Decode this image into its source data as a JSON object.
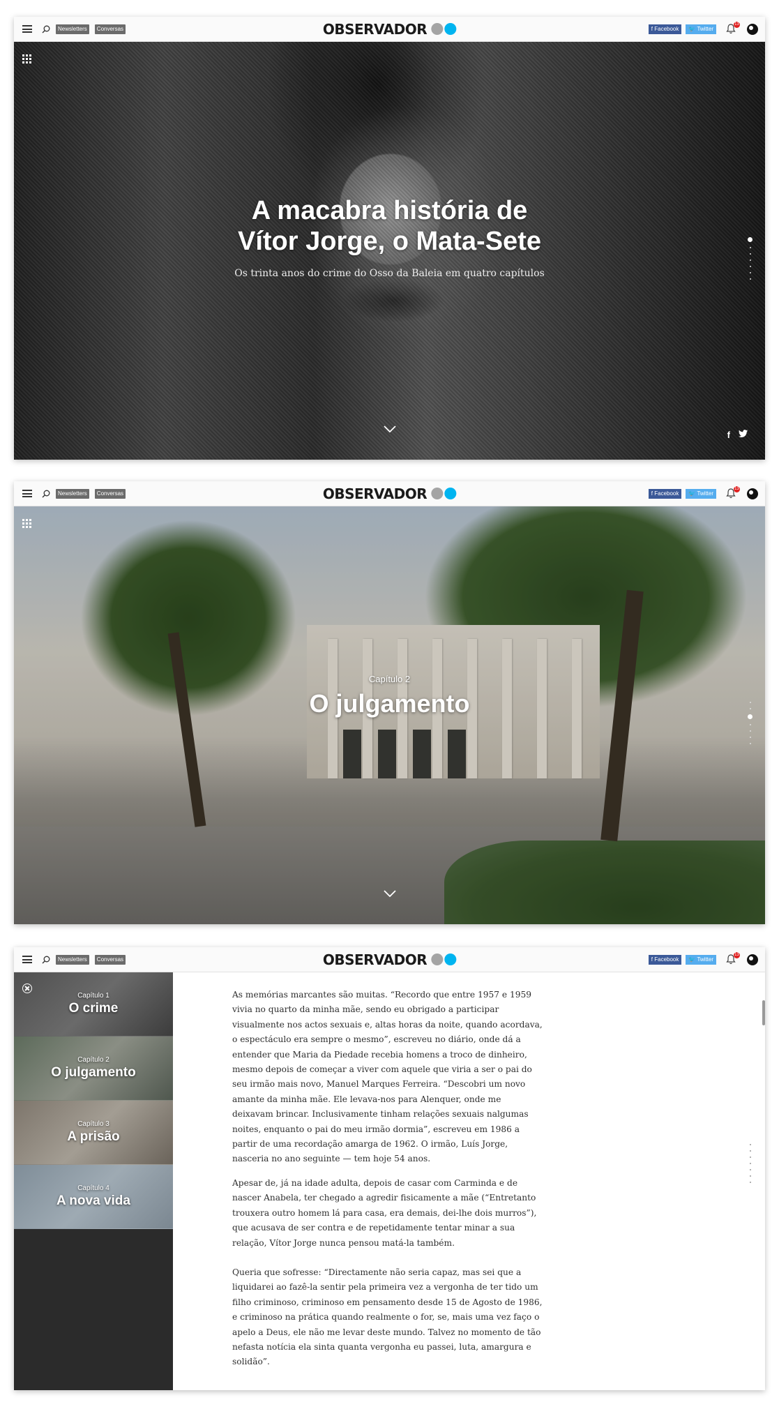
{
  "header": {
    "logo": "OBSERVADOR",
    "newsletters": "Newsletters",
    "conversas": "Conversas",
    "facebook": "Facebook",
    "twitter": "Twitter",
    "notifications": "13",
    "icons": [
      "menu-icon",
      "search-icon",
      "bell-icon"
    ]
  },
  "hero": {
    "title": "A macabra história de Vítor Jorge, o Mata-Sete",
    "subtitle": "Os trinta anos do crime do Osso da Baleia em quatro capítulos"
  },
  "chapter_slide": {
    "kicker": "Capítulo 2",
    "title": "O julgamento"
  },
  "sidebar": {
    "chapters": [
      {
        "kicker": "Capítulo 1",
        "title": "O crime"
      },
      {
        "kicker": "Capítulo 2",
        "title": "O julgamento"
      },
      {
        "kicker": "Capítulo 3",
        "title": "A prisão"
      },
      {
        "kicker": "Capítulo 4",
        "title": "A nova vida"
      }
    ]
  },
  "article": {
    "paragraphs": [
      "As memórias marcantes são muitas. “Recordo que entre 1957 e 1959 vivia no quarto da minha mãe, sendo eu obrigado a participar visualmente nos actos sexuais e, altas horas da noite, quando acordava, o espectáculo era sempre o mesmo”, escreveu no diário, onde dá a entender que Maria da Piedade recebia homens a troco de dinheiro, mesmo depois de começar a viver com aquele que viria a ser o pai do seu irmão mais novo, Manuel Marques Ferreira. “Descobri um novo amante da minha mãe. Ele levava-nos para Alenquer, onde me deixavam brincar. Inclusivamente tinham relações sexuais nalgumas noites, enquanto o pai do meu irmão dormia”, escreveu em 1986 a partir de uma recordação amarga de 1962. O irmão, Luís Jorge, nasceria no ano seguinte — tem hoje 54 anos.",
      "Apesar de, já na idade adulta, depois de casar com Carminda e de nascer Anabela, ter chegado a agredir fisicamente a mãe (“Entretanto trouxera outro homem lá para casa, era demais, dei-lhe dois murros”), que acusava de ser contra e de repetidamente tentar minar a sua relação, Vítor Jorge nunca pensou matá-la também.",
      "Queria que sofresse: “Directamente não seria capaz, mas sei que a liquidarei ao fazê-la sentir pela primeira vez a vergonha de ter tido um filho criminoso, criminoso em pensamento desde 15 de Agosto de 1986, e criminoso na prática quando realmente o for, se, mais uma vez faço o apelo a Deus, ele não me levar deste mundo. Talvez no momento de tão nefasta notícia ela sinta quanta vergonha eu passei, luta, amargura e solidão”."
    ]
  },
  "colors": {
    "brand_blue": "#00b4f0",
    "brand_grey": "#a4a4a4",
    "facebook": "#3b5998",
    "twitter": "#55acee"
  }
}
